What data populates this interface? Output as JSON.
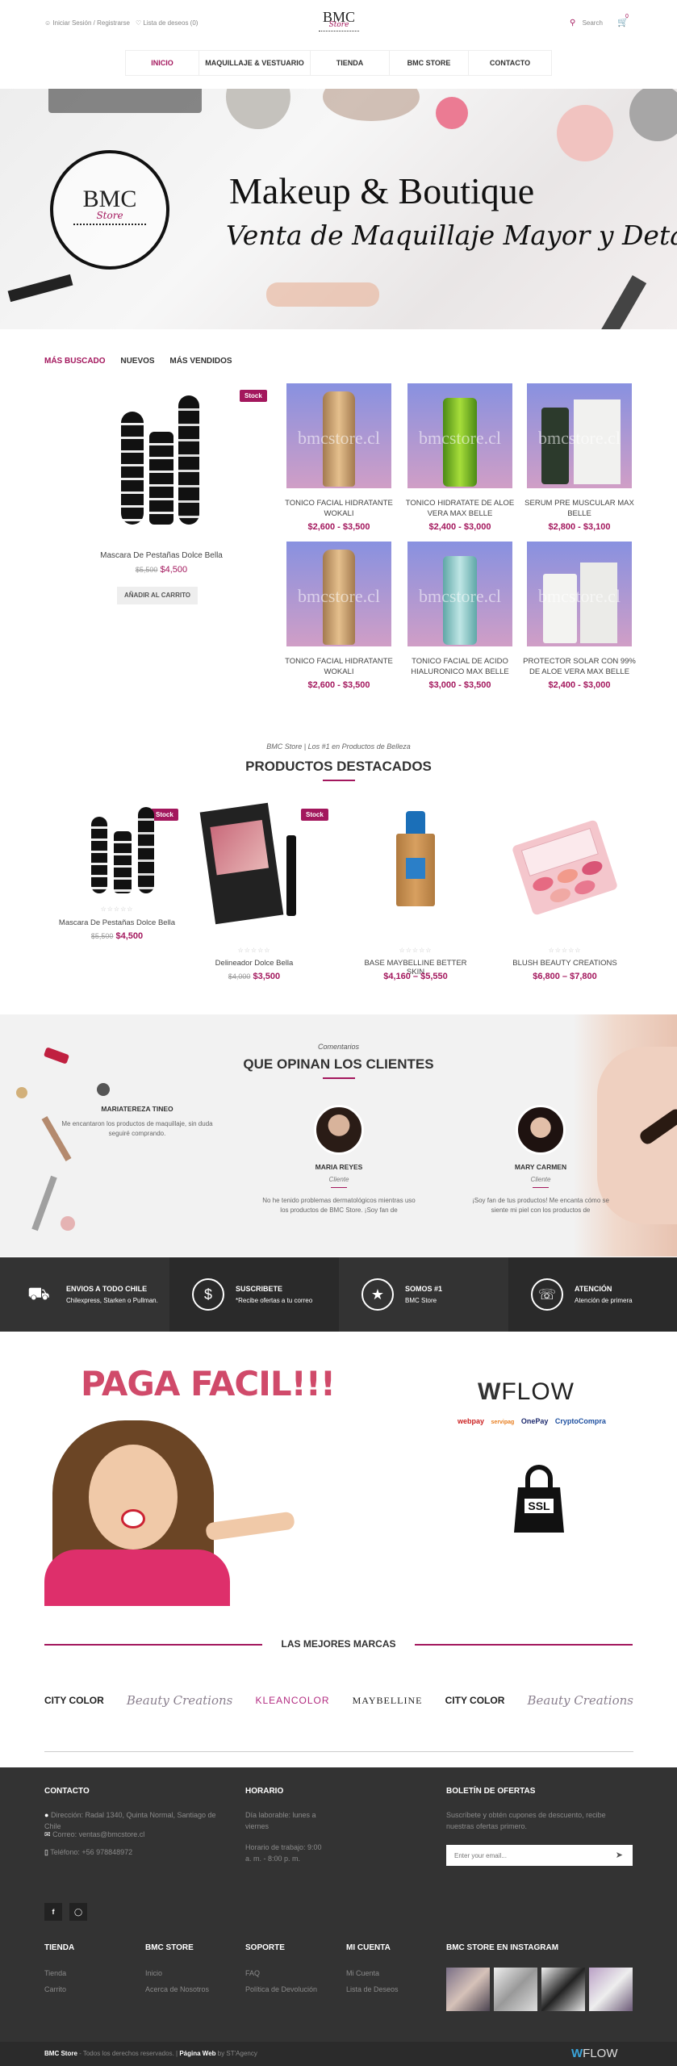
{
  "header": {
    "login": "Iniciar Sesión / Registrarse",
    "wishlist": "Lista de deseos (0)",
    "logo_text": "BMC",
    "logo_sub": "Store",
    "search": "Search",
    "cart_count": "0"
  },
  "nav": [
    "INICIO",
    "MAQUILLAJE & VESTUARIO",
    "TIENDA",
    "BMC STORE",
    "CONTACTO"
  ],
  "hero": {
    "circle_title": "BMC",
    "circle_sub": "Store",
    "title": "Makeup & Boutique",
    "subtitle": "Venta de Maquillaje Mayor y Detal"
  },
  "tabs": [
    "MÁS BUSCADO",
    "NUEVOS",
    "MÁS VENDIDOS"
  ],
  "featured_left": {
    "badge": "Stock",
    "name": "Mascara De Pestañas Dolce Bella",
    "old_price": "$5,500",
    "price": "$4,500",
    "button": "AÑADIR AL CARRITO"
  },
  "watermark": "bmcstore.cl",
  "grid_products": [
    {
      "name": "TONICO FACIAL HIDRATANTE WOKALI",
      "price": "$2,600 - $3,500"
    },
    {
      "name": "TONICO HIDRATATE DE ALOE VERA MAX BELLE",
      "price": "$2,400 - $3,000"
    },
    {
      "name": "SERUM PRE MUSCULAR MAX BELLE",
      "price": "$2,800 - $3,100"
    },
    {
      "name": "TONICO FACIAL HIDRATANTE WOKALI",
      "price": "$2,600 - $3,500"
    },
    {
      "name": "TONICO FACIAL DE ACIDO HIALURONICO MAX BELLE",
      "price": "$3,000 - $3,500"
    },
    {
      "name": "PROTECTOR SOLAR CON 99% DE ALOE VERA MAX BELLE",
      "price": "$2,400 - $3,000"
    }
  ],
  "destacados": {
    "kicker": "BMC Store | Los #1 en Productos de Belleza",
    "title": "PRODUCTOS DESTACADOS",
    "items": [
      {
        "badge": "Stock",
        "stars": "☆☆☆☆☆",
        "name": "Mascara De Pestañas Dolce Bella",
        "old": "$5,500",
        "price": "$4,500"
      },
      {
        "badge": "Stock",
        "stars": "☆☆☆☆☆",
        "name": "Delineador Dolce Bella",
        "old": "$4,000",
        "price": "$3,500"
      },
      {
        "badge": "",
        "stars": "☆☆☆☆☆",
        "name": "BASE MAYBELLINE BETTER SKIN",
        "old": "",
        "price": "$4,160 – $5,550"
      },
      {
        "badge": "",
        "stars": "☆☆☆☆☆",
        "name": "BLUSH BEAUTY CREATIONS",
        "old": "",
        "price": "$6,800 – $7,800"
      }
    ]
  },
  "testimonials": {
    "kicker": "Comentarios",
    "title": "QUE OPINAN LOS CLIENTES",
    "items": [
      {
        "name": "MARIATEREZA TINEO",
        "role": "",
        "text": "Me encantaron los productos de maquillaje, sin duda seguiré comprando."
      },
      {
        "name": "MARIA REYES",
        "role": "Cliente",
        "text": "No he tenido problemas dermatológicos mientras uso los productos de BMC Store. ¡Soy fan de"
      },
      {
        "name": "MARY CARMEN",
        "role": "Cliente",
        "text": "¡Soy fan de tus productos! Me encanta cómo se siente mi piel con los productos de"
      }
    ]
  },
  "features": [
    {
      "icon": "truck-icon",
      "title": "ENVIOS A TODO CHILE",
      "text": "Chilexpress, Starken o Pullman."
    },
    {
      "icon": "dollar-icon",
      "title": "SUSCRIBETE",
      "text": "*Recibe ofertas a tu correo"
    },
    {
      "icon": "award-icon",
      "title": "SOMOS #1",
      "text": "BMC Store"
    },
    {
      "icon": "headset-icon",
      "title": "ATENCIÓN",
      "text": "Atención de primera"
    }
  ],
  "payment": {
    "title": "PAGA FACIL!!!",
    "flow": "FLOW",
    "methods": [
      "webpay",
      "servipag",
      "OnePay",
      "CryptoCompra"
    ],
    "ssl": "SSL"
  },
  "brands": {
    "title": "LAS MEJORES MARCAS",
    "items": [
      "CITY COLOR",
      "Beauty Creations",
      "KLEANCOLOR",
      "MAYBELLINE",
      "CITY COLOR",
      "Beauty Creations"
    ]
  },
  "footer": {
    "contact_title": "CONTACTO",
    "address": "Dirección: Radal 1340, Quinta Normal, Santiago de Chile",
    "email": "Correo: ventas@bmcstore.cl",
    "phone": "Teléfono: +56 978848972",
    "hours_title": "HORARIO",
    "hours1": "Día laborable: lunes a viernes",
    "hours2": "Horario de trabajo: 9:00 a. m. - 8:00 p. m.",
    "news_title": "BOLETÍN DE OFERTAS",
    "news_text": "Suscríbete y obtén cupones de descuento, recibe nuestras ofertas primero.",
    "news_placeholder": "Enter your email...",
    "cols": [
      {
        "title": "TIENDA",
        "links": [
          "Tienda",
          "Carrito"
        ]
      },
      {
        "title": "BMC STORE",
        "links": [
          "Inicio",
          "Acerca de Nosotros"
        ]
      },
      {
        "title": "SOPORTE",
        "links": [
          "FAQ",
          "Política de Devolución"
        ]
      },
      {
        "title": "MI CUENTA",
        "links": [
          "Mi Cuenta",
          "Lista de Deseos"
        ]
      }
    ],
    "insta_title": "BMC STORE EN INSTAGRAM",
    "copy_brand": "BMC Store",
    "copy_text": " - Todos los derechos reservados. | ",
    "copy_web": "Página Web",
    "copy_by": " by ST'Agency",
    "flow": "FLOW"
  }
}
